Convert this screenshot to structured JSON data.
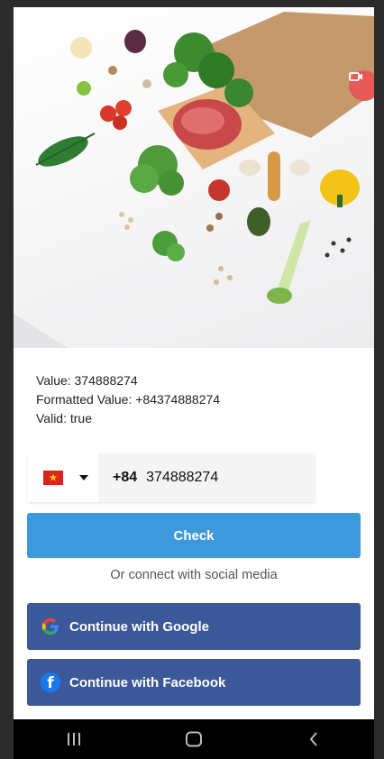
{
  "hero": {
    "record_label": "ᴑ"
  },
  "info": {
    "value_line": "Value: 374888274",
    "formatted_line": "Formatted Value: +84374888274",
    "valid_line": "Valid: true"
  },
  "phone": {
    "country_flag_icon": "vietnam-flag-icon",
    "dial_code": "+84",
    "number": "374888274"
  },
  "actions": {
    "check_label": "Check",
    "or_text": "Or connect with social media",
    "google_label": "Continue with Google",
    "facebook_label": "Continue with Facebook"
  },
  "colors": {
    "check": "#3c99dc",
    "social": "#3b5998",
    "record": "#e45b57"
  }
}
